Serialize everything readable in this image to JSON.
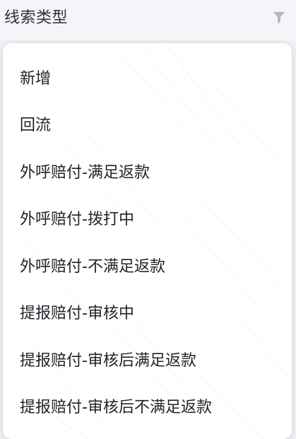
{
  "header": {
    "title": "线索类型",
    "icon": "filter-icon"
  },
  "dropdown": {
    "options": [
      {
        "label": "新增"
      },
      {
        "label": "回流"
      },
      {
        "label": "外呼赔付-满足返款"
      },
      {
        "label": "外呼赔付-拨打中"
      },
      {
        "label": "外呼赔付-不满足返款"
      },
      {
        "label": "提报赔付-审核中"
      },
      {
        "label": "提报赔付-审核后满足返款"
      },
      {
        "label": "提报赔付-审核后不满足返款"
      }
    ]
  },
  "colors": {
    "background": "#f0f1f4",
    "text": "#1f2329",
    "icon": "#b4b8bf"
  }
}
